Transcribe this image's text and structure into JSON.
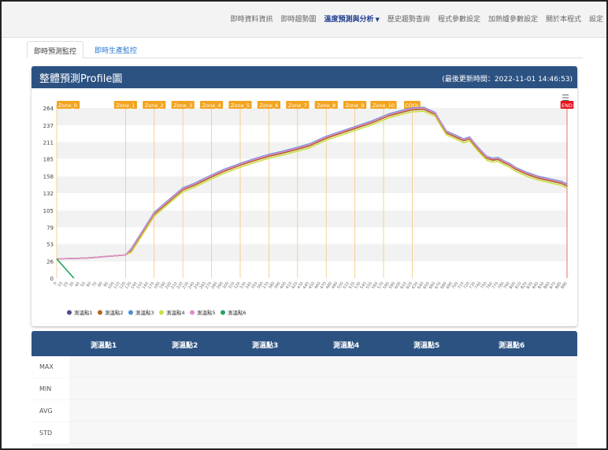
{
  "nav": {
    "items": [
      {
        "label": "即時資料資訊",
        "active": false
      },
      {
        "label": "即時趨勢圖",
        "active": false
      },
      {
        "label": "溫度預測與分析",
        "active": true,
        "dropdown": true
      },
      {
        "label": "歷史趨勢查詢",
        "active": false
      },
      {
        "label": "程式參數設定",
        "active": false
      },
      {
        "label": "加熱爐參數設定",
        "active": false
      },
      {
        "label": "關於本程式",
        "active": false
      },
      {
        "label": "設定",
        "active": false
      }
    ]
  },
  "tabs": {
    "active": "即時預測監控",
    "inactive": "即時生產監控"
  },
  "panel": {
    "title": "整體預測Profile圖",
    "updated": "(最後更新時間：2022-11-01 14:46:53)",
    "menu_icon": "hamburger-icon"
  },
  "chart_data": {
    "type": "line",
    "ylim": [
      0,
      264
    ],
    "yticks": [
      0,
      26,
      53,
      79,
      105,
      132,
      158,
      185,
      211,
      237,
      264
    ],
    "x_count": 90,
    "x_label_start": 0,
    "x_label_step": 10,
    "zones": [
      {
        "label": "Zone_0",
        "x": 0
      },
      {
        "label": "Zone_1",
        "x": 12
      },
      {
        "label": "Zone_2",
        "x": 17
      },
      {
        "label": "Zone_3",
        "x": 22
      },
      {
        "label": "Zone_4",
        "x": 27
      },
      {
        "label": "Zone_5",
        "x": 32
      },
      {
        "label": "Zone_6",
        "x": 37
      },
      {
        "label": "Zone_7",
        "x": 42
      },
      {
        "label": "Zone_8",
        "x": 47
      },
      {
        "label": "Zone_9",
        "x": 52
      },
      {
        "label": "Zone_10",
        "x": 57
      },
      {
        "label": "COOL",
        "x": 62
      },
      {
        "label": "END",
        "x": 89
      }
    ],
    "series": [
      {
        "name": "測溫點1",
        "color": "#4b4b8f",
        "offset": 0
      },
      {
        "name": "測溫點2",
        "color": "#b5651d",
        "offset": -1
      },
      {
        "name": "測溫點3",
        "color": "#4a90d9",
        "offset": 2
      },
      {
        "name": "測溫點4",
        "color": "#c9df44",
        "offset": -4
      },
      {
        "name": "測溫點5",
        "color": "#e38ccd",
        "offset": 1
      },
      {
        "name": "測溫點6",
        "color": "#1fa45c",
        "offset": 0,
        "short": true
      }
    ],
    "base_points": [
      [
        0,
        30
      ],
      [
        5,
        31
      ],
      [
        12,
        36
      ],
      [
        13,
        44
      ],
      [
        15,
        72
      ],
      [
        17,
        100
      ],
      [
        20,
        123
      ],
      [
        22,
        138
      ],
      [
        24,
        145
      ],
      [
        27,
        158
      ],
      [
        29,
        166
      ],
      [
        32,
        176
      ],
      [
        34,
        182
      ],
      [
        37,
        190
      ],
      [
        39,
        194
      ],
      [
        42,
        201
      ],
      [
        44,
        206
      ],
      [
        47,
        218
      ],
      [
        49,
        224
      ],
      [
        52,
        233
      ],
      [
        55,
        242
      ],
      [
        58,
        253
      ],
      [
        61,
        260
      ],
      [
        62,
        262
      ],
      [
        64,
        263
      ],
      [
        66,
        255
      ],
      [
        67,
        240
      ],
      [
        68,
        226
      ],
      [
        70,
        218
      ],
      [
        71,
        214
      ],
      [
        72,
        217
      ],
      [
        73,
        206
      ],
      [
        74,
        196
      ],
      [
        75,
        187
      ],
      [
        76,
        184
      ],
      [
        77,
        185
      ],
      [
        78,
        180
      ],
      [
        79,
        176
      ],
      [
        80,
        170
      ],
      [
        82,
        162
      ],
      [
        84,
        156
      ],
      [
        86,
        152
      ],
      [
        88,
        148
      ],
      [
        89,
        144
      ]
    ],
    "short_points": [
      [
        0,
        30
      ],
      [
        3,
        0
      ]
    ]
  },
  "stats": {
    "columns": [
      "測溫點1",
      "測溫點2",
      "測溫點3",
      "測溫點4",
      "測溫點5",
      "測溫點6"
    ],
    "rows": [
      "MAX",
      "MIN",
      "AVG",
      "STD"
    ]
  }
}
